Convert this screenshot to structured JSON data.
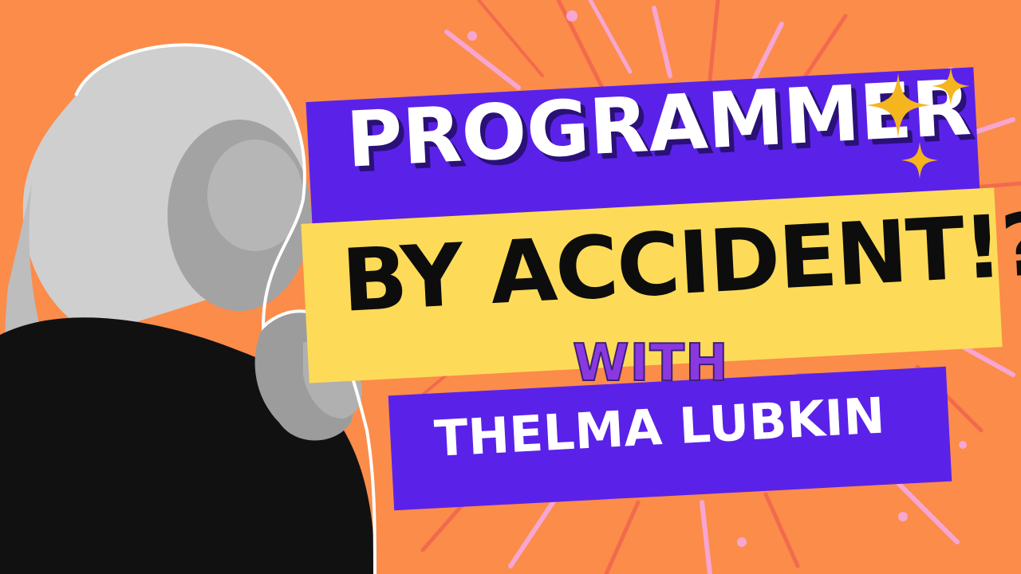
{
  "thumbnail": {
    "line1": "PROGRAMMER",
    "line2": "BY ACCIDENT!?",
    "with": "WITH",
    "name": "THELMA LUBKIN"
  },
  "colors": {
    "background": "#fb8c4a",
    "banner_purple": "#5a22e8",
    "banner_yellow": "#fddb58",
    "burst_pink": "#f7a6d2",
    "burst_red": "#f26a4e",
    "sparkle_gold": "#f4b51f",
    "with_text": "#8a39e0"
  },
  "icons": {
    "sparkles": "sparkle-icon",
    "portrait": "portrait-photo"
  }
}
